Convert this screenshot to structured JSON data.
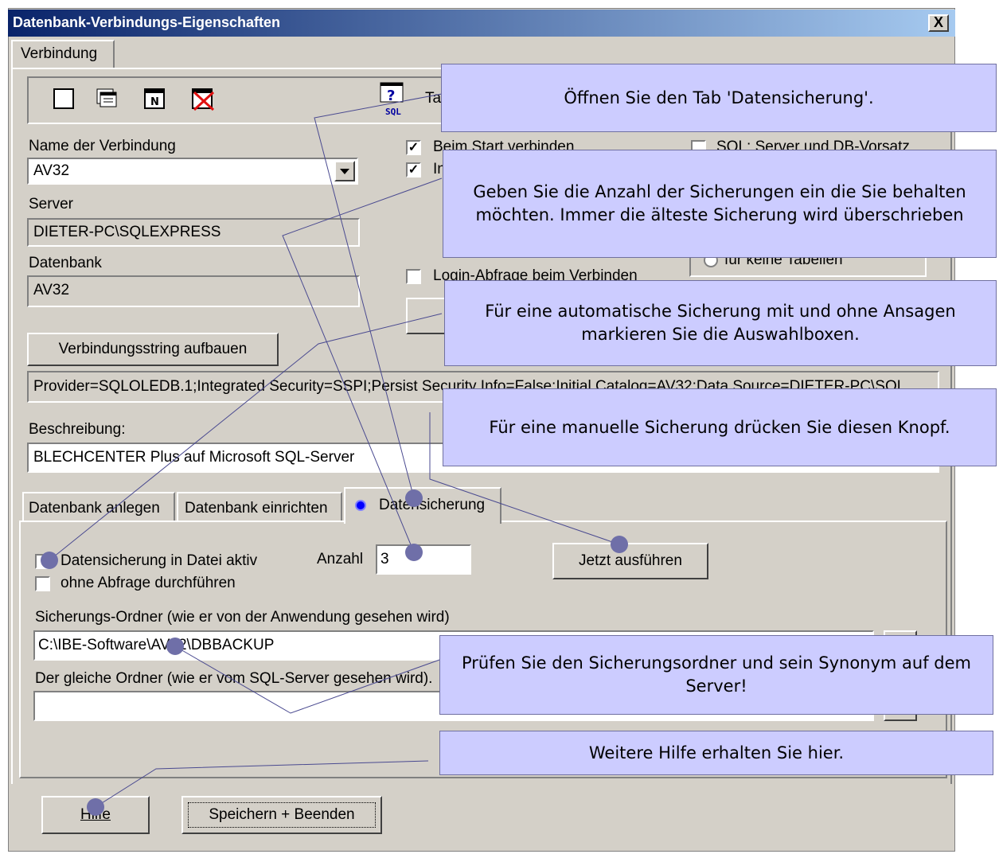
{
  "window": {
    "title": "Datenbank-Verbindungs-Eigenschaften",
    "close_label": "X"
  },
  "top_tab": {
    "label": "Verbindung"
  },
  "toolbar": {
    "icons": [
      "new-window-icon",
      "multi-window-icon",
      "n-window-icon",
      "delete-window-icon",
      "sql-help-icon"
    ],
    "partial_label": "Ta"
  },
  "connection": {
    "name_label": "Name der Verbindung",
    "name_value": "AV32",
    "server_label": "Server",
    "server_value": "DIETER-PC\\SQLEXPRESS",
    "database_label": "Datenbank",
    "database_value": "AV32",
    "build_button": "Verbindungsstring aufbauen",
    "conn_string": "Provider=SQLOLEDB.1;Integrated Security=SSPI;Persist Security Info=False;Initial Catalog=AV32;Data Source=DIETER-PC\\SQL",
    "description_label": "Beschreibung:",
    "description_value": "BLECHCENTER Plus auf Microsoft SQL-Server"
  },
  "options": {
    "start_connect": "Beim Start verbinden",
    "start_connect_checked": true,
    "second_partial": "In",
    "second_checked": true,
    "login_prompt": "Login-Abfrage beim Verbinden",
    "login_checked": false,
    "sql_prefix": "SQL: Server und DB-Vorsatz",
    "sql_prefix_checked": false,
    "radio_partial": "für keine Tabellen"
  },
  "sub_tabs": [
    {
      "label": "Datenbank anlegen"
    },
    {
      "label": "Datenbank einrichten"
    },
    {
      "label": "Datensicherung"
    }
  ],
  "backup": {
    "active_label": "Datensicherung in Datei aktiv",
    "active_checked": false,
    "noprompt_label": "ohne Abfrage durchführen",
    "noprompt_checked": false,
    "count_label": "Anzahl",
    "count_value": "3",
    "run_button": "Jetzt ausführen",
    "folder_label": "Sicherungs-Ordner (wie er von der Anwendung gesehen wird)",
    "folder_value": "C:\\IBE-Software\\AV32\\DBBACKUP",
    "server_folder_label": "Der gleiche Ordner (wie er vom SQL-Server gesehen wird).",
    "server_folder_value": ""
  },
  "footer": {
    "help_button": "Hilfe",
    "save_button": "Speichern + Beenden"
  },
  "callouts": {
    "c1": "Öffnen Sie den Tab 'Datensicherung'.",
    "c2": "Geben Sie die Anzahl der Sicherungen ein die Sie behalten möchten. Immer die älteste Sicherung wird überschrieben",
    "c3": "Für eine automatische Sicherung mit und ohne Ansagen markieren Sie die Auswahlboxen.",
    "c4": "Für eine manuelle Sicherung drücken Sie diesen Knopf.",
    "c5": "Prüfen Sie den Sicherungsordner und sein Synonym auf dem Server!",
    "c6": "Weitere Hilfe erhalten Sie hier."
  },
  "colors": {
    "callout_bg": "#ccccff",
    "titlebar": "#0a246a",
    "marker": "#6f6fa8",
    "dialog_bg": "#d4d0c8"
  }
}
